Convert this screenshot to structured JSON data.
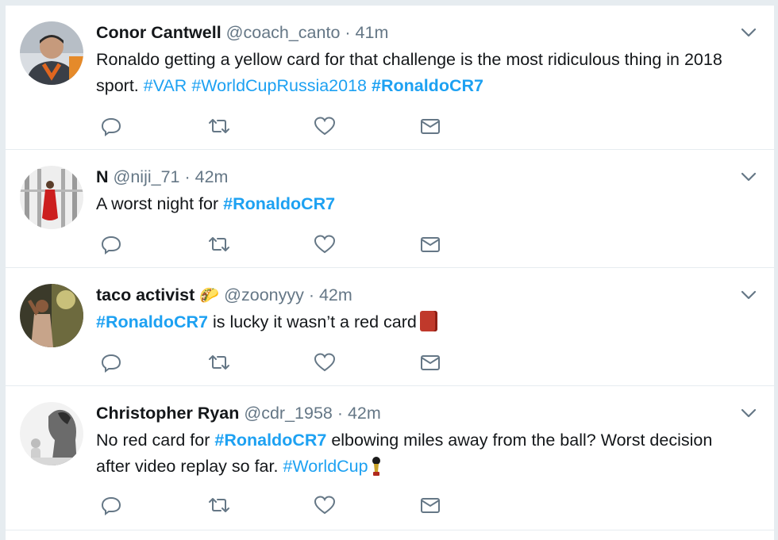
{
  "tweets": [
    {
      "name": "Conor Cantwell",
      "handle": "@coach_canto",
      "time": "· 41m",
      "text_parts": [
        {
          "t": "Ronaldo getting a yellow card for that challenge is the most ridiculous thing in 2018 sport. ",
          "k": "text"
        },
        {
          "t": "#VAR",
          "k": "tag"
        },
        {
          "t": " ",
          "k": "text"
        },
        {
          "t": "#WorldCupRussia2018",
          "k": "tag"
        },
        {
          "t": " ",
          "k": "text"
        },
        {
          "t": "#RonaldoCR7",
          "k": "tagbold"
        }
      ]
    },
    {
      "name": "N",
      "handle": "@niji_71",
      "time": "· 42m",
      "text_parts": [
        {
          "t": "A worst night for ",
          "k": "text"
        },
        {
          "t": "#RonaldoCR7",
          "k": "tagbold"
        }
      ]
    },
    {
      "name": "taco activist",
      "name_emoji": "🌮",
      "handle": "@zoonyyy",
      "time": "· 42m",
      "text_parts": [
        {
          "t": "#RonaldoCR7",
          "k": "tagbold"
        },
        {
          "t": " is lucky it wasn’t a red card",
          "k": "text"
        }
      ],
      "trailing_icon": "red-card-emoji"
    },
    {
      "name": "Christopher Ryan",
      "handle": "@cdr_1958",
      "time": "· 42m",
      "text_parts": [
        {
          "t": "No red card for ",
          "k": "text"
        },
        {
          "t": "#RonaldoCR7",
          "k": "tagbold"
        },
        {
          "t": " elbowing miles away from the ball? Worst decision after video replay so far. ",
          "k": "text"
        },
        {
          "t": "#WorldCup",
          "k": "tag"
        }
      ],
      "trailing_icon": "world-cup-trophy-emoji"
    }
  ],
  "icons": {
    "reply": "reply-icon",
    "retweet": "retweet-icon",
    "like": "like-icon",
    "message": "direct-message-icon",
    "menu": "chevron-down-icon"
  },
  "colors": {
    "link": "#1da1f2",
    "text": "#14171a",
    "muted": "#657786",
    "divider": "#e6ecf0"
  }
}
